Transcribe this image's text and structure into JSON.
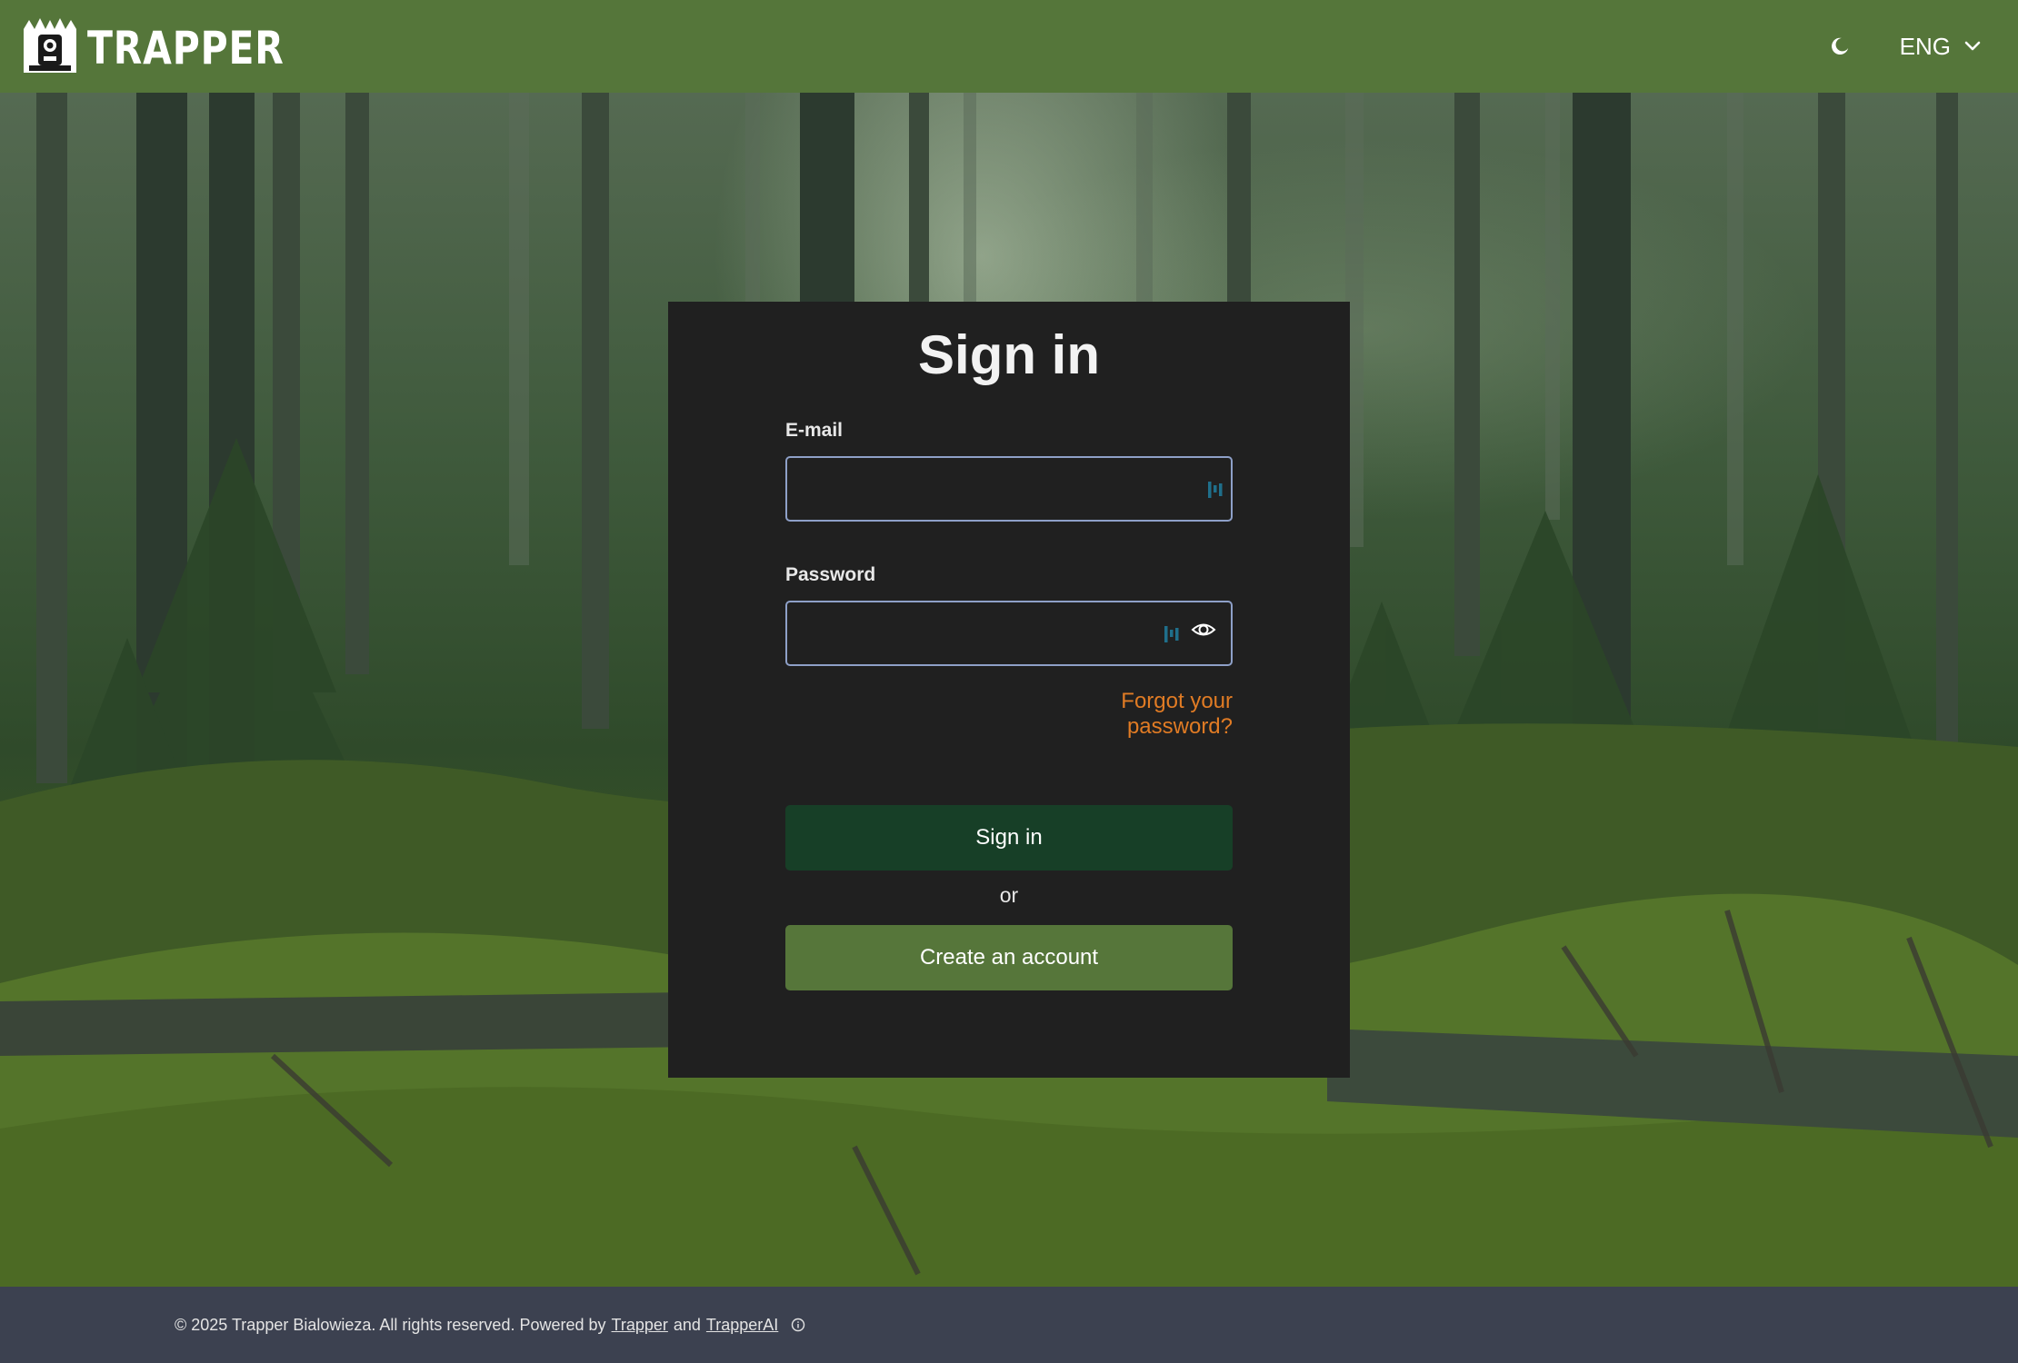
{
  "header": {
    "brand_name": "TRAPPER",
    "theme_icon": "moon-icon",
    "language": "ENG",
    "language_icon": "chevron-down-icon",
    "background_color": "#55763a"
  },
  "login": {
    "title": "Sign in",
    "email_label": "E-mail",
    "email_value": "",
    "password_label": "Password",
    "password_value": "",
    "password_toggle_icon": "eye-icon",
    "forgot_link": "Forgot your password?",
    "signin_button": "Sign in",
    "or_text": "or",
    "create_account_button": "Create an account"
  },
  "footer": {
    "copyright": "© 2025 Trapper Bialowieza. All rights reserved. Powered by",
    "link_trapper": "Trapper",
    "and_text": "and",
    "link_trapperai": "TrapperAI",
    "info_icon": "info-icon"
  },
  "colors": {
    "accent_orange": "#e07b24",
    "signin_button": "#173f27",
    "create_button": "#56763a",
    "card_background": "#202020",
    "footer_background": "#3c4150"
  }
}
